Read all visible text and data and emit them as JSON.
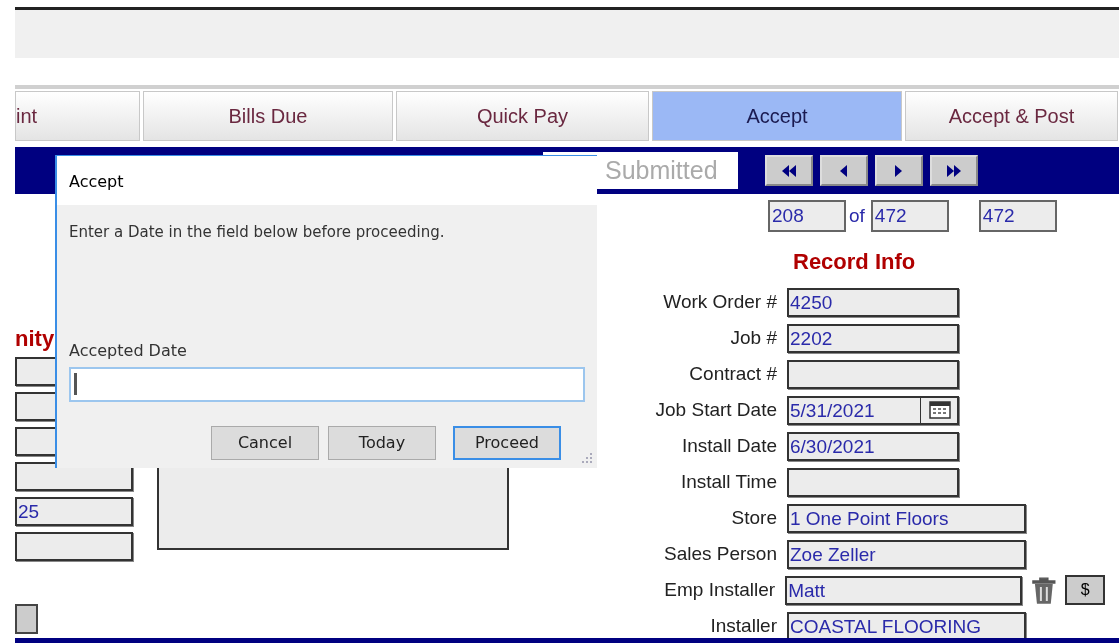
{
  "tabs": [
    {
      "label": "int",
      "selected": false
    },
    {
      "label": "Bills Due",
      "selected": false
    },
    {
      "label": "Quick Pay",
      "selected": false
    },
    {
      "label": "Accept",
      "selected": true
    },
    {
      "label": "Accept & Post",
      "selected": false
    }
  ],
  "nav_bar": {
    "status_field": {
      "placeholder": "Submitted"
    },
    "buttons": [
      {
        "kind": "first"
      },
      {
        "kind": "previous"
      },
      {
        "kind": "next"
      },
      {
        "kind": "last"
      }
    ]
  },
  "record_counter": {
    "current": "208",
    "of_label": "of",
    "total": "472",
    "count": "472"
  },
  "left_panel": {
    "title": "nity",
    "fields": [
      {
        "kind": "text"
      },
      {
        "kind": "text"
      },
      {
        "kind": "text"
      },
      {
        "kind": "text"
      },
      {
        "kind": "text",
        "value": "25"
      },
      {
        "kind": "text"
      }
    ]
  },
  "record_info": {
    "title": "Record Info",
    "fields": [
      {
        "label": "Work Order #",
        "value": "4250",
        "kind": "short"
      },
      {
        "label": "Job #",
        "value": "2202",
        "kind": "short"
      },
      {
        "label": "Contract #",
        "kind": "short"
      },
      {
        "label": "Job Start Date",
        "value": "5/31/2021",
        "kind": "date"
      },
      {
        "label": "Install Date",
        "value": "6/30/2021",
        "kind": "short"
      },
      {
        "label": "Install Time",
        "kind": "short"
      },
      {
        "label": "Store",
        "value": "1 One Point Floors",
        "kind": "long"
      },
      {
        "label": "Sales Person",
        "value": "Zoe Zeller",
        "kind": "long"
      },
      {
        "label": "Emp Installer",
        "value": "Matt",
        "kind": "long",
        "actions": [
          {
            "kind": "trash"
          },
          {
            "kind": "button",
            "label": "$"
          }
        ]
      },
      {
        "label": "Installer",
        "value": "COASTAL FLOORING",
        "kind": "long"
      }
    ]
  },
  "dialog": {
    "title": "Accept",
    "message": "Enter a Date in the field below before proceeding.",
    "field_label": "Accepted Date",
    "buttons": [
      {
        "label": "Cancel",
        "default": false
      },
      {
        "label": "Today",
        "default": false
      },
      {
        "label": "Proceed",
        "default": true
      }
    ]
  }
}
